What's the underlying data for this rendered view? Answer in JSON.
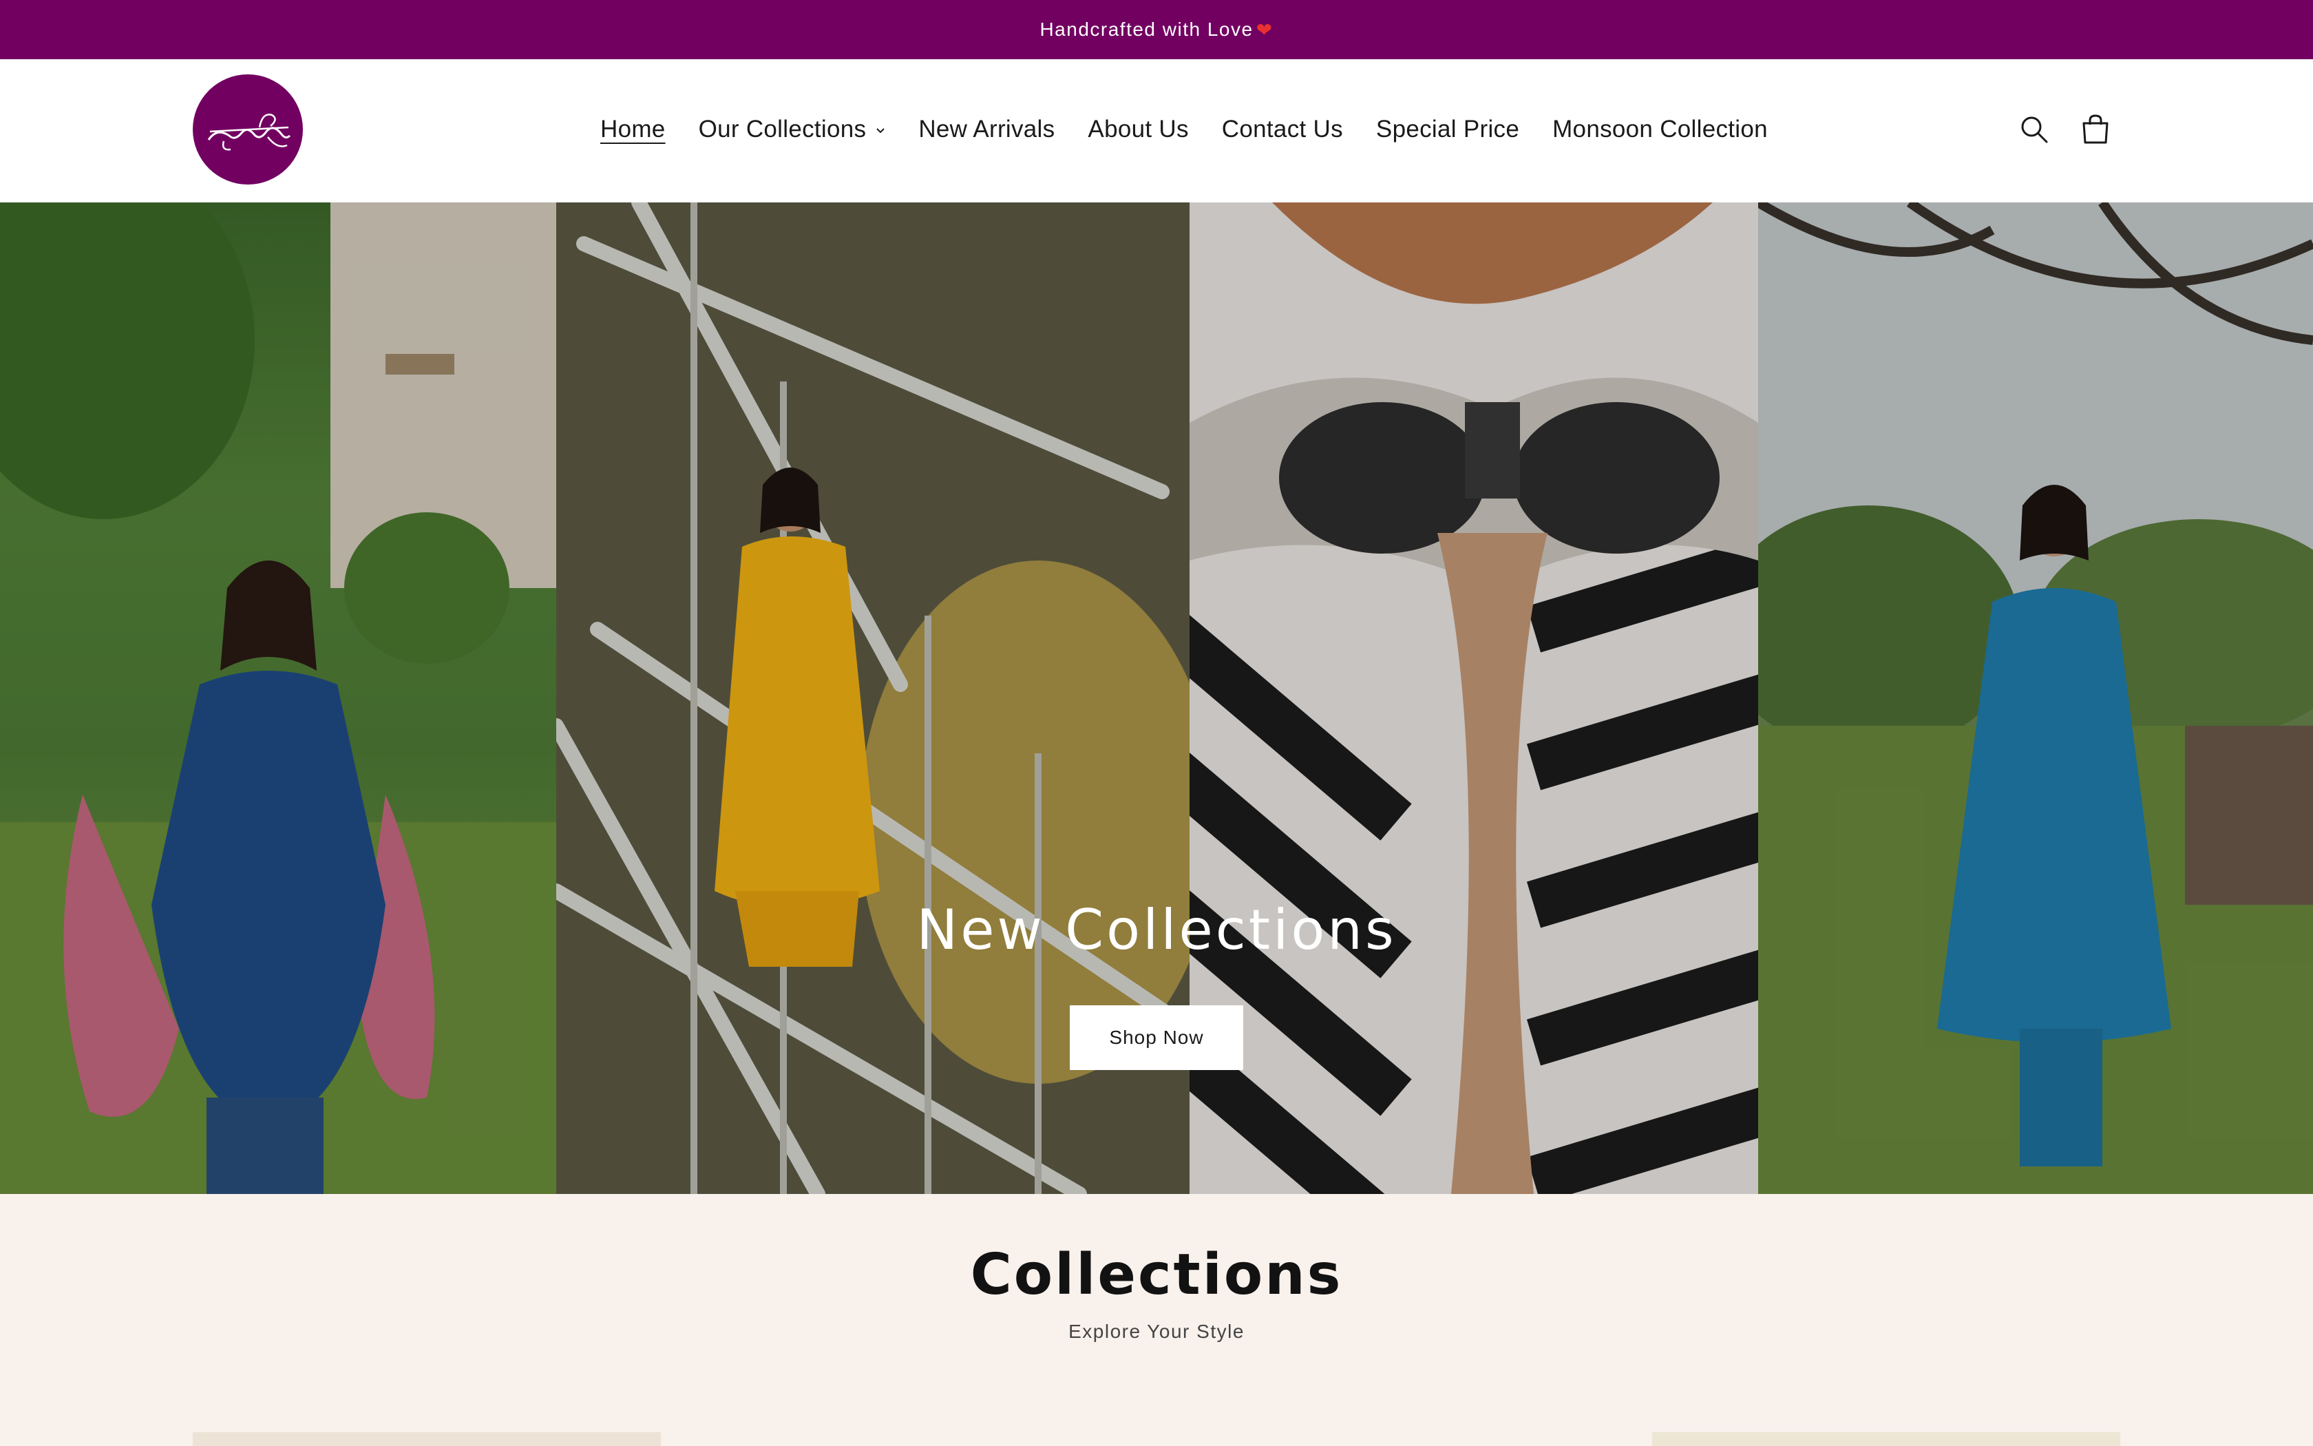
{
  "announcement": {
    "text": "Handcrafted with Love",
    "heart": "❤"
  },
  "header": {
    "logo_icon": "brand-logo",
    "nav": [
      {
        "label": "Home",
        "active": true
      },
      {
        "label": "Our Collections",
        "has_dropdown": true
      },
      {
        "label": "New Arrivals"
      },
      {
        "label": "About Us"
      },
      {
        "label": "Contact Us"
      },
      {
        "label": "Special Price"
      },
      {
        "label": "Monsoon Collection"
      }
    ],
    "icons": [
      "search-icon",
      "cart-icon"
    ]
  },
  "hero": {
    "title": "New Collections",
    "button_label": "Shop Now"
  },
  "collections": {
    "title": "Collections",
    "subtitle": "Explore Your Style"
  },
  "colors": {
    "brand": "#720061",
    "background": "#f8f1ec",
    "text": "#121212"
  }
}
